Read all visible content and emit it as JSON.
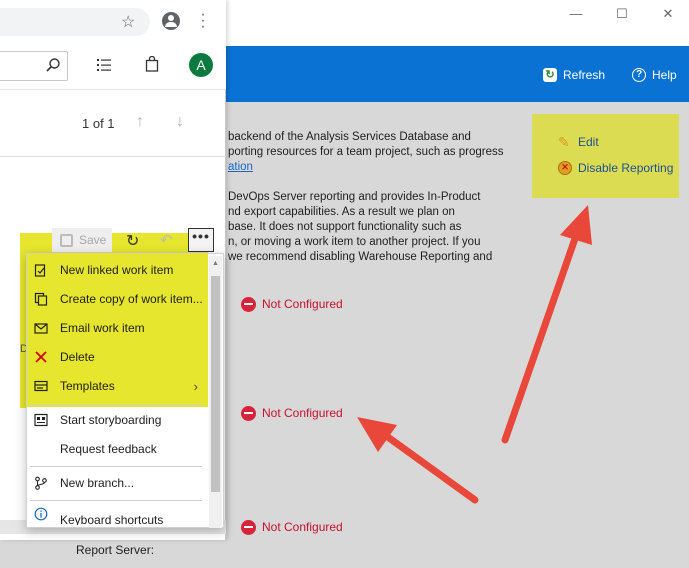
{
  "window": {
    "minimize_glyph": "—",
    "maximize_glyph": "☐",
    "close_glyph": "✕"
  },
  "header": {
    "refresh_label": "Refresh",
    "help_label": "Help"
  },
  "content": {
    "lines": [
      "backend of the Analysis Services Database and",
      "porting resources for a team project, such as progress",
      "ation",
      "DevOps Server reporting and provides In-Product",
      "nd export capabilities. As a result we plan on",
      "base. It does not support functionality such as",
      "n, or moving a work item to another project. If you",
      "we recommend disabling Warehouse Reporting and"
    ],
    "status_rows": [
      "Not Configured",
      "Not Configured",
      "Not Configured"
    ],
    "report_server_label": "Report Server:"
  },
  "actions": {
    "edit_label": "Edit",
    "disable_label": "Disable Reporting"
  },
  "browser": {
    "avatar_letter": "A",
    "pager": "1 of 1",
    "save_label": "Save",
    "more_glyph": "•••",
    "tab_stub": "D"
  },
  "menu": {
    "items": [
      {
        "label": "New linked work item",
        "icon": "new-linked-icon"
      },
      {
        "label": "Create copy of work item...",
        "icon": "copy-icon"
      },
      {
        "label": "Email work item",
        "icon": "email-icon"
      },
      {
        "label": "Delete",
        "icon": "delete-icon"
      },
      {
        "label": "Templates",
        "icon": "templates-icon"
      },
      {
        "label": "Start storyboarding",
        "icon": "storyboard-icon"
      },
      {
        "label": "Request feedback",
        "icon": ""
      },
      {
        "label": "New branch...",
        "icon": "branch-icon"
      },
      {
        "label": "Keyboard shortcuts",
        "icon": "info-icon"
      }
    ]
  },
  "colors": {
    "accent": "#0a72d2",
    "highlight": "#e6e62e",
    "error": "#c8102e",
    "arrow": "#e8473a"
  }
}
